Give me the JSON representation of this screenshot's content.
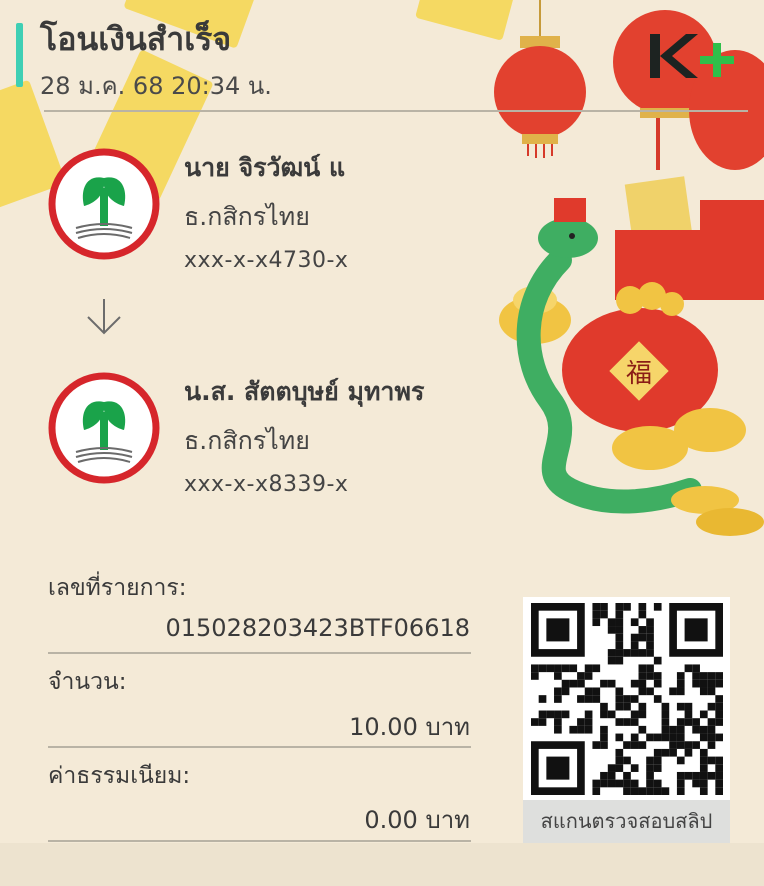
{
  "header": {
    "title": "โอนเงินสำเร็จ",
    "datetime": "28 ม.ค. 68  20:34 น."
  },
  "brand": {
    "logo_icon": "kplus-logo-icon",
    "accent": "#3fcfb4"
  },
  "sender": {
    "name": "นาย จิรวัฒน์ แ",
    "bank": "ธ.กสิกรไทย",
    "account": "xxx-x-x4730-x",
    "logo_icon": "kasikorn-bank-logo-icon"
  },
  "receiver": {
    "name": "น.ส. สัตตบุษย์ มุทาพร",
    "bank": "ธ.กสิกรไทย",
    "account": "xxx-x-x8339-x",
    "logo_icon": "kasikorn-bank-logo-icon"
  },
  "transaction": {
    "ref_label": "เลขที่รายการ:",
    "ref_value": "015028203423BTF06618",
    "amount_label": "จำนวน:",
    "amount_value": "10.00 บาท",
    "fee_label": "ค่าธรรมเนียม:",
    "fee_value": "0.00 บาท"
  },
  "qr": {
    "caption": "สแกนตรวจสอบสลิป",
    "icon": "qr-code-icon"
  },
  "colors": {
    "kbank_green": "#1aa34a",
    "kbank_red": "#d6262b",
    "background": "#f4ead7"
  }
}
